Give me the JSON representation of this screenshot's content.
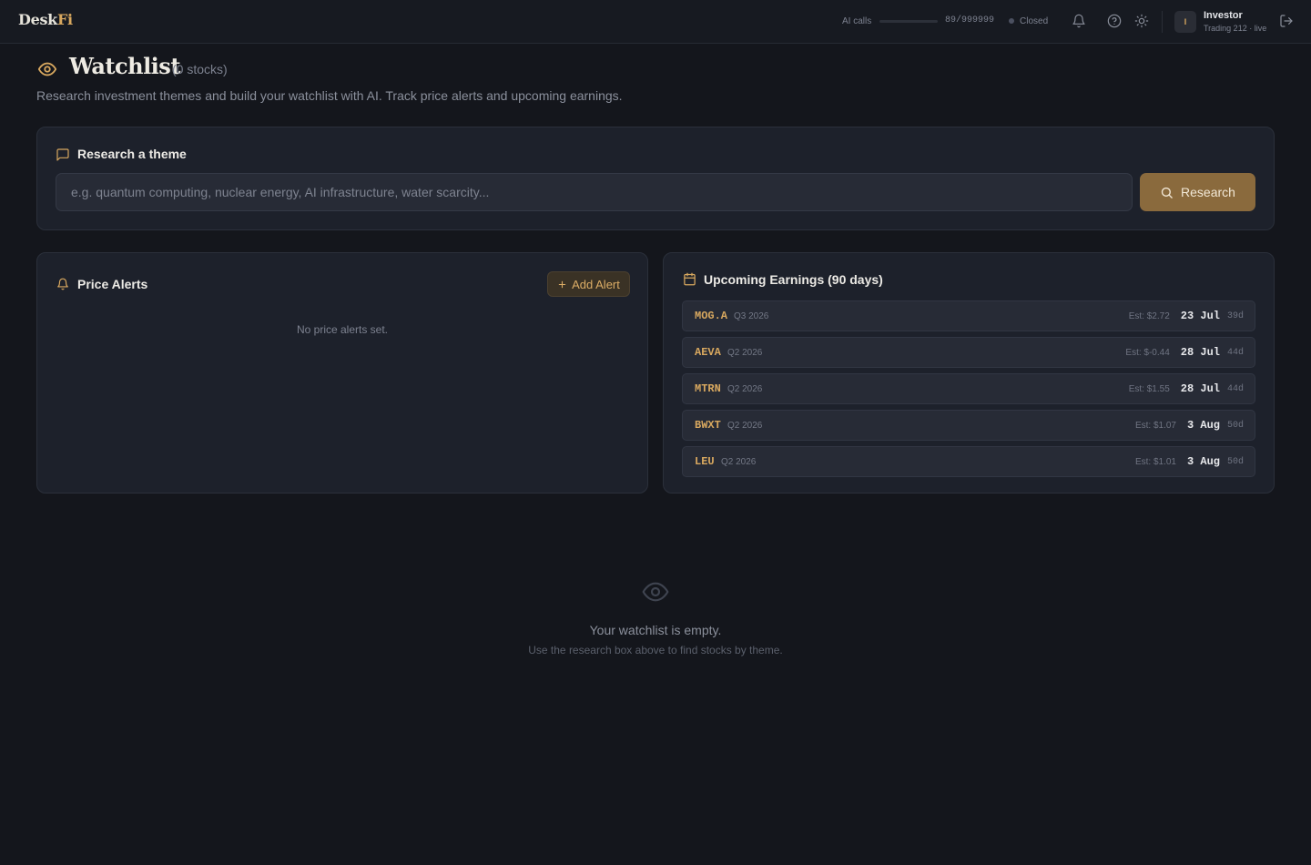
{
  "app": {
    "logo_part1": "Desk",
    "logo_part2": "Fi"
  },
  "header": {
    "ai_calls_label": "AI calls",
    "ai_calls_count": "89/999999",
    "ai_calls_fraction": 0.0001,
    "market_status": "Closed",
    "icons": [
      "bell-icon",
      "help-icon",
      "sun-icon",
      "logout-icon"
    ],
    "user": {
      "initial": "I",
      "name": "Investor",
      "subtitle": "Trading 212 · live"
    }
  },
  "page": {
    "title": "Watchlist",
    "count": "(0 stocks)",
    "subtitle": "Research investment themes and build your watchlist with AI. Track price alerts and upcoming earnings."
  },
  "research": {
    "title": "Research a theme",
    "placeholder": "e.g. quantum computing, nuclear energy, AI infrastructure, water scarcity...",
    "value": "",
    "button_label": "Research"
  },
  "alerts": {
    "title": "Price Alerts",
    "add_label": "Add Alert",
    "empty_text": "No price alerts set."
  },
  "earnings": {
    "title": "Upcoming Earnings (90 days)",
    "rows": [
      {
        "ticker": "MOG.A",
        "quarter": "Q3 2026",
        "estimate": "Est: $2.72",
        "date": "23 Jul",
        "days": "39d"
      },
      {
        "ticker": "AEVA",
        "quarter": "Q2 2026",
        "estimate": "Est: $-0.44",
        "date": "28 Jul",
        "days": "44d"
      },
      {
        "ticker": "MTRN",
        "quarter": "Q2 2026",
        "estimate": "Est: $1.55",
        "date": "28 Jul",
        "days": "44d"
      },
      {
        "ticker": "BWXT",
        "quarter": "Q2 2026",
        "estimate": "Est: $1.07",
        "date": "3 Aug",
        "days": "50d"
      },
      {
        "ticker": "LEU",
        "quarter": "Q2 2026",
        "estimate": "Est: $1.01",
        "date": "3 Aug",
        "days": "50d"
      }
    ]
  },
  "empty_state": {
    "title": "Your watchlist is empty.",
    "subtitle": "Use the research box above to find stocks by theme."
  },
  "colors": {
    "background": "#14161c",
    "card": "#1d212b",
    "accent": "#d8a85f",
    "button": "#8a6a3d"
  }
}
